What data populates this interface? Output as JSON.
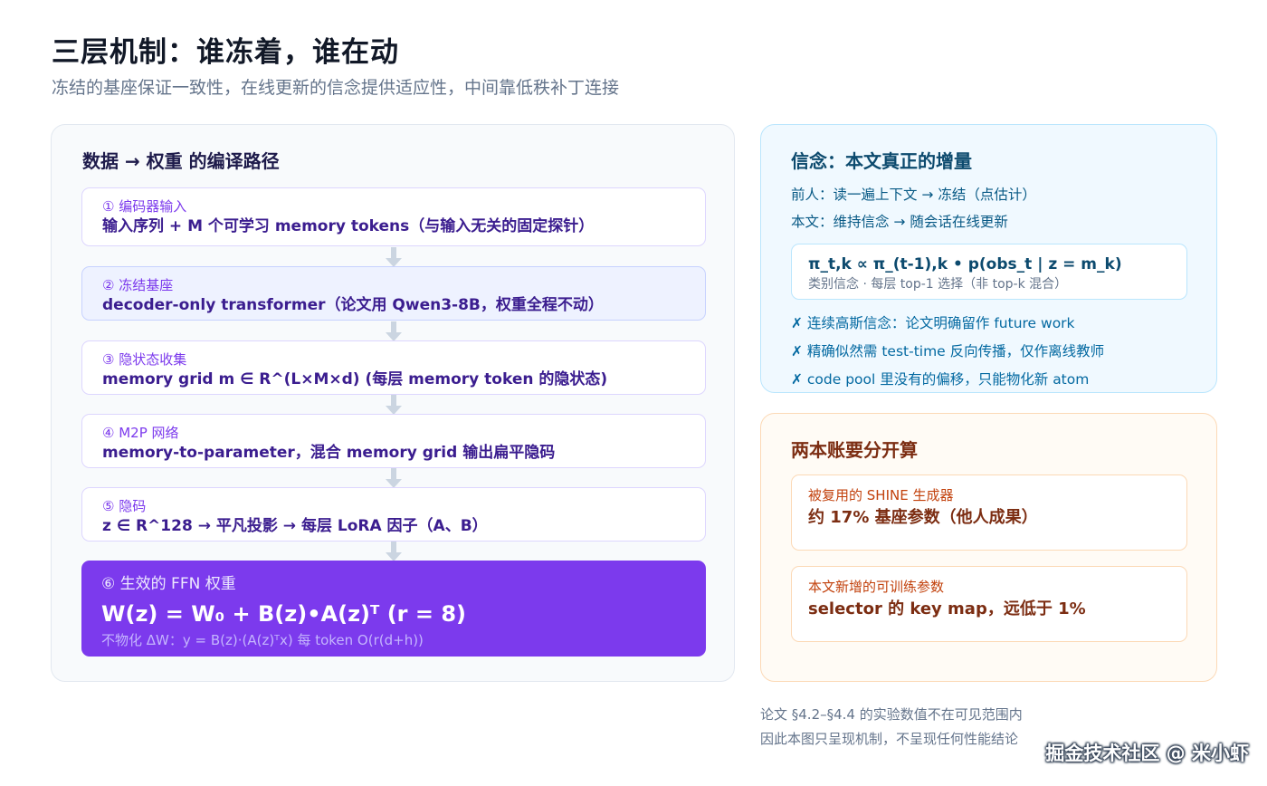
{
  "header": {
    "title": "三层机制：谁冻着，谁在动",
    "subtitle": "冻结的基座保证一致性，在线更新的信念提供适应性，中间靠低秩补丁连接"
  },
  "pipeline": {
    "title": "数据 → 权重 的编译路径",
    "steps": [
      {
        "label": "① 编码器输入",
        "desc": "输入序列 + M 个可学习 memory tokens（与输入无关的固定探针）"
      },
      {
        "label": "② 冻结基座",
        "desc": "decoder-only transformer（论文用 Qwen3-8B，权重全程不动）"
      },
      {
        "label": "③ 隐状态收集",
        "desc": "memory grid    m ∈ R^(L×M×d)      (每层 memory token 的隐状态)"
      },
      {
        "label": "④ M2P 网络",
        "desc": "memory-to-parameter，混合 memory grid 输出扁平隐码"
      },
      {
        "label": "⑤ 隐码",
        "desc": "z ∈ R^128    → 平凡投影 → 每层 LoRA 因子（A、B）"
      }
    ],
    "final": {
      "label": "⑥ 生效的 FFN 权重",
      "formula": "W(z) = W₀ + B(z)•A(z)ᵀ      (r = 8)",
      "note": "不物化 ΔW：y = B(z)·(A(z)ᵀx)    每 token O(r(d+h))"
    }
  },
  "belief": {
    "title": "信念：本文真正的增量",
    "prior_line": "前人：读一遍上下文 → 冻结（点估计）",
    "this_line": "本文：维持信念 → 随会话在线更新",
    "formula": "π_t,k ∝ π_(t-1),k • p(obs_t | z = m_k)",
    "formula_note": "类别信念 · 每层 top-1 选择（非 top-k 混合）",
    "limits": [
      "✗ 连续高斯信念：论文明确留作 future work",
      "✗ 精确似然需 test-time 反向传播，仅作离线教师",
      "✗ code pool 里没有的偏移，只能物化新 atom"
    ]
  },
  "ledger": {
    "title": "两本账要分开算",
    "items": [
      {
        "label": "被复用的 SHINE 生成器",
        "value": "约 17% 基座参数（他人成果）"
      },
      {
        "label": "本文新增的可训练参数",
        "value": "selector 的 key map，远低于 1%"
      }
    ]
  },
  "footnote": {
    "line1": "论文 §4.2–§4.4 的实验数值不在可见范围内",
    "line2": "因此本图只呈现机制，不呈现任何性能结论"
  },
  "watermark": "掘金技术社区 @ 米小虾"
}
